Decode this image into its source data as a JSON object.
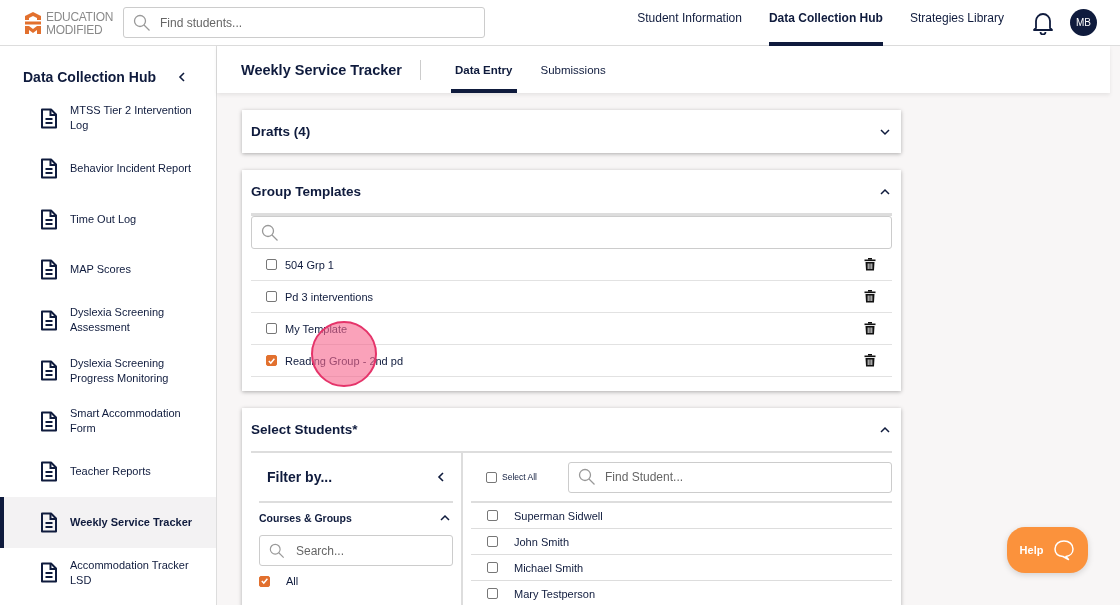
{
  "header": {
    "logo": {
      "line_1": "EDUCATION",
      "line_2": "MODIFIED"
    },
    "search": {
      "placeholder": "Find students..."
    },
    "nav": [
      {
        "label": "Student Information",
        "selected": false
      },
      {
        "label": "Data Collection Hub",
        "selected": true
      },
      {
        "label": "Strategies Library",
        "selected": false
      }
    ],
    "avatar": "MB"
  },
  "sidebar": {
    "title": "Data Collection Hub",
    "items": [
      {
        "label": "MTSS Tier 2 Intervention Log",
        "selected": false
      },
      {
        "label": "Behavior Incident Report",
        "selected": false
      },
      {
        "label": "Time Out Log",
        "selected": false
      },
      {
        "label": "MAP Scores",
        "selected": false
      },
      {
        "label": "Dyslexia Screening Assessment",
        "selected": false
      },
      {
        "label": "Dyslexia Screening Progress Monitoring",
        "selected": false
      },
      {
        "label": "Smart Accommodation Form",
        "selected": false
      },
      {
        "label": "Teacher Reports",
        "selected": false
      },
      {
        "label": "Weekly Service Tracker",
        "selected": true
      },
      {
        "label": "Accommodation Tracker LSD",
        "selected": false
      }
    ]
  },
  "page": {
    "title": "Weekly Service Tracker",
    "tabs": [
      {
        "label": "Data Entry",
        "selected": true
      },
      {
        "label": "Submissions",
        "selected": false
      }
    ]
  },
  "drafts": {
    "title": "Drafts (4)",
    "expanded": false
  },
  "group_templates": {
    "title": "Group Templates",
    "expanded": true,
    "items": [
      {
        "label": "504 Grp 1",
        "checked": false
      },
      {
        "label": "Pd 3 interventions",
        "checked": false
      },
      {
        "label": "My Template",
        "checked": false
      },
      {
        "label": "Reading Group - 2nd pd",
        "checked": true
      }
    ]
  },
  "select_students": {
    "title": "Select Students*",
    "expanded": true,
    "filter": {
      "title": "Filter by...",
      "section": {
        "title": "Courses & Groups",
        "expanded": true,
        "search_placeholder": "Search...",
        "options": [
          {
            "label": "All",
            "checked": true
          }
        ]
      }
    },
    "select_all": {
      "label": "Select All",
      "checked": false
    },
    "search_placeholder": "Find Student...",
    "students": [
      {
        "name": "Superman Sidwell",
        "checked": false
      },
      {
        "name": "John Smith",
        "checked": false
      },
      {
        "name": "Michael Smith",
        "checked": false
      },
      {
        "name": "Mary Testperson",
        "checked": false
      }
    ]
  },
  "help_button": {
    "label": "Help"
  }
}
